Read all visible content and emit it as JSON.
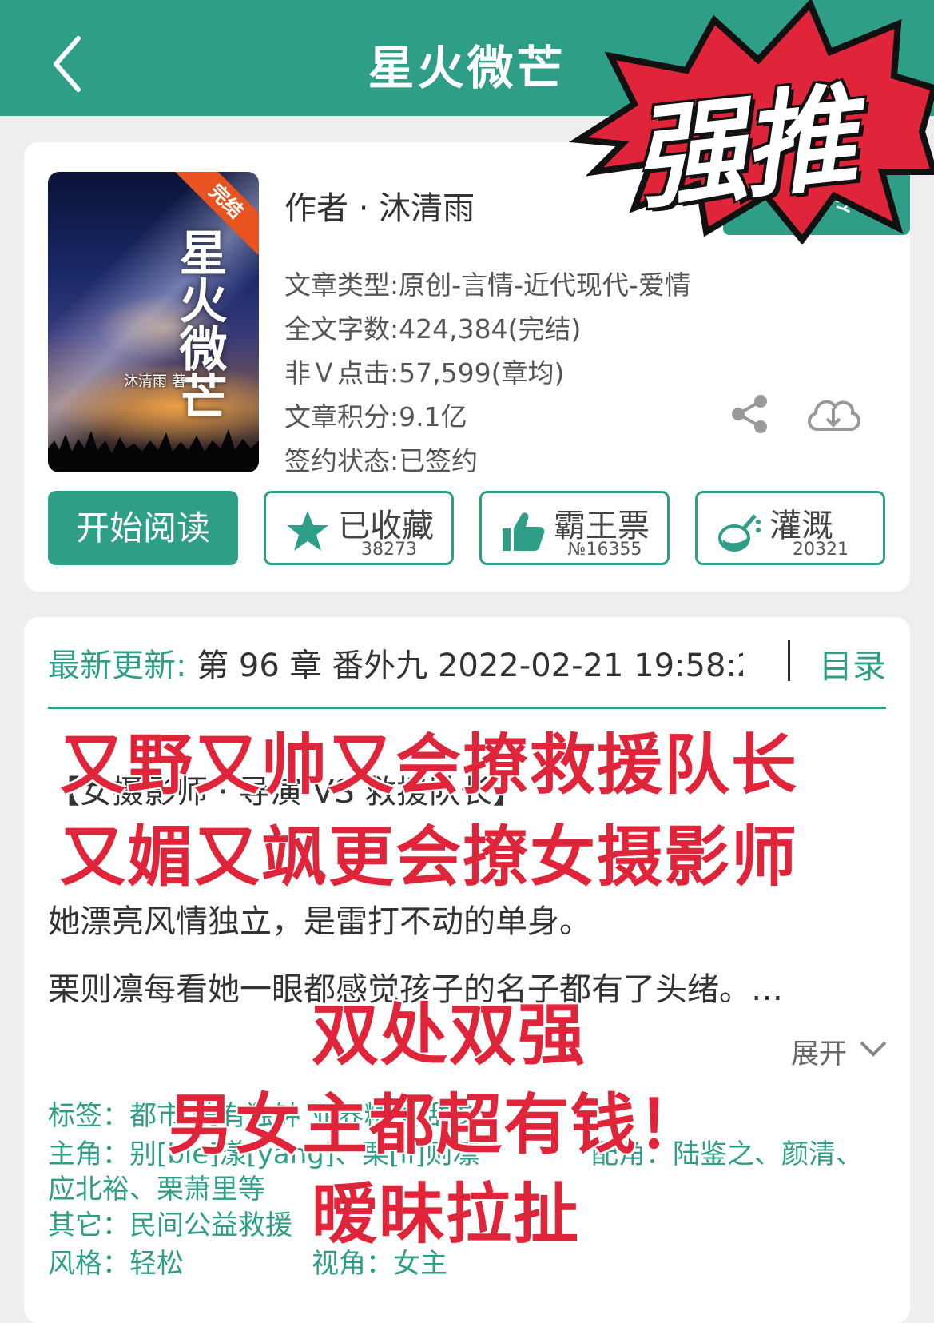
{
  "header": {
    "title": "星火微芒"
  },
  "cover": {
    "badge": "完结",
    "title": "星火微芒",
    "author": "沐清雨 著"
  },
  "book": {
    "author": "作者 · 沐清雨",
    "author_button": "作者专栏",
    "meta": [
      "文章类型:原创-言情-近代现代-爱情",
      "全文字数:424,384(完结)",
      "非Ｖ点击:57,599(章均)",
      "文章积分:9.1亿",
      "签约状态:已签约"
    ]
  },
  "actions": {
    "read": "开始阅读",
    "buttons": [
      {
        "label": "已收藏",
        "count": "38273",
        "icon": "star-icon"
      },
      {
        "label": "霸王票",
        "count": "№16355",
        "icon": "thumbs-up-icon"
      },
      {
        "label": "灌溉",
        "count": "20321",
        "icon": "watering-flask-icon"
      }
    ]
  },
  "latest": {
    "label": "最新更新:",
    "value": "第 96 章 番外九 2022-02-21 19:58:2",
    "toc": "目录"
  },
  "intro": {
    "bracket": "【女摄影师 · 导演 VS 救援队长】",
    "lines": [
      "她漂亮风情独立，是雷打不动的单身。",
      "栗则凛每看她一眼都感觉孩子的名子都有了头绪。…"
    ],
    "expand": "展开"
  },
  "tags": {
    "labels": "标签：都市 情有独钟 业界精英 甜文",
    "protagonists": "主角：别[bie]漾[yang]、栗[li]则凛",
    "supporting": "配角：陆鉴之、颜清、",
    "supporting_cont": "应北裕、栗萧里等",
    "other": "其它：民间公益救援",
    "style": "风格：轻松",
    "perspective": "视角：女主"
  },
  "overlays": {
    "burst": "强推",
    "line1": "又野又帅又会撩救援队长",
    "line2": "又媚又飒更会撩女摄影师",
    "line3": "双处双强",
    "line4": "男女主都超有钱！",
    "line5": "暧昧拉扯"
  },
  "colors": {
    "accent": "#2e9e87",
    "overlay_red": "#e0253a",
    "ribbon": "#e8531f"
  }
}
